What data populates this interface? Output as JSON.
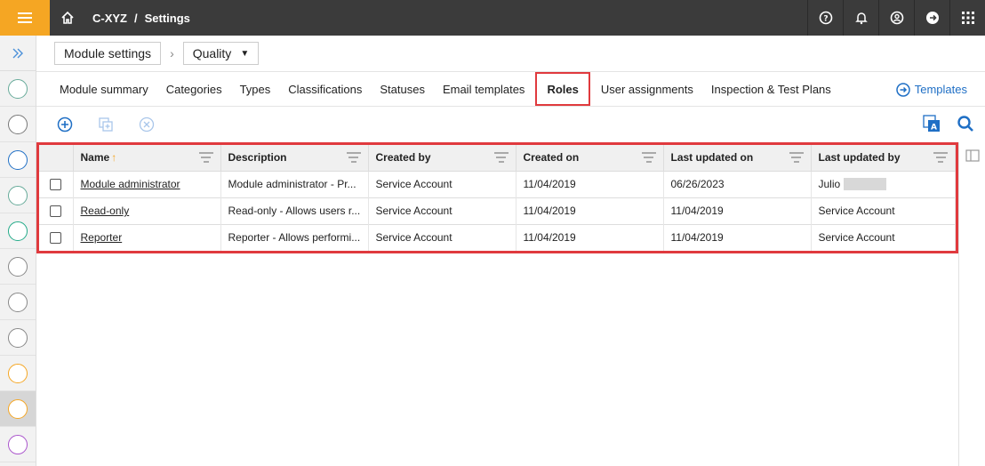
{
  "breadcrumb": {
    "org": "C-XYZ",
    "separator": "/",
    "page": "Settings"
  },
  "controls": {
    "module_settings": "Module settings",
    "module_select": "Quality"
  },
  "tabs": [
    "Module summary",
    "Categories",
    "Types",
    "Classifications",
    "Statuses",
    "Email templates",
    "Roles",
    "User assignments",
    "Inspection & Test Plans"
  ],
  "active_tab": "Roles",
  "templates_link": "Templates",
  "table": {
    "columns": [
      "Name",
      "Description",
      "Created by",
      "Created on",
      "Last updated on",
      "Last updated by"
    ],
    "rows": [
      [
        "Module administrator",
        "Module administrator - Pr...",
        "Service Account",
        "11/04/2019",
        "06/26/2023",
        "Julio"
      ],
      [
        "Read-only",
        "Read-only - Allows users r...",
        "Service Account",
        "11/04/2019",
        "11/04/2019",
        "Service Account"
      ],
      [
        "Reporter",
        "Reporter - Allows performi...",
        "Service Account",
        "11/04/2019",
        "11/04/2019",
        "Service Account"
      ]
    ]
  },
  "colors": {
    "accent": "#f5a623",
    "topbar": "#3b3b3b",
    "highlight": "#e03a3e",
    "link": "#1f6fc5"
  }
}
